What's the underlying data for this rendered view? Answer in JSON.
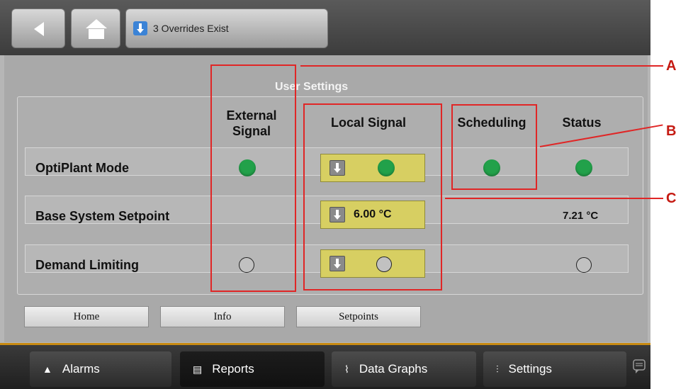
{
  "topbar": {
    "overrides_text": "3 Overrides Exist"
  },
  "panel": {
    "title": "User Settings",
    "columns": {
      "external": "External Signal",
      "local": "Local Signal",
      "scheduling": "Scheduling",
      "status": "Status"
    },
    "rows": [
      {
        "label": "OptiPlant Mode",
        "external": "on",
        "local": "on",
        "scheduling": "on",
        "status": "on"
      },
      {
        "label": "Base System Setpoint",
        "local_value": "6.00 °C",
        "status_value": "7.21 °C"
      },
      {
        "label": "Demand Limiting",
        "external": "off",
        "local": "off",
        "status": "off"
      }
    ]
  },
  "buttons": {
    "home": "Home",
    "info": "Info",
    "setpoints": "Setpoints"
  },
  "nav": {
    "alarms": "Alarms",
    "reports": "Reports",
    "data_graphs": "Data Graphs",
    "settings": "Settings"
  },
  "callouts": {
    "a": "A",
    "b": "B",
    "c": "C"
  },
  "colors": {
    "indicator_on": "#22a14a",
    "override_button": "#d7cf62",
    "accent": "#c88a12",
    "annotation": "#e02626"
  }
}
